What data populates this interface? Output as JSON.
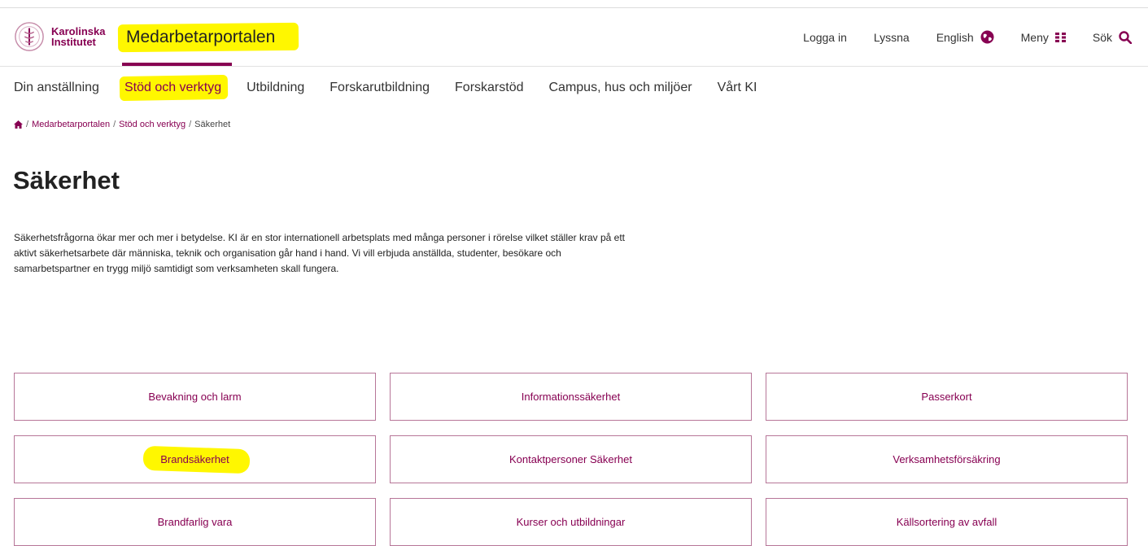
{
  "header": {
    "logo_line1": "Karolinska",
    "logo_line2": "Institutet",
    "portal_title": "Medarbetarportalen",
    "actions": {
      "login": "Logga in",
      "listen": "Lyssna",
      "language": "English",
      "menu": "Meny",
      "search": "Sök"
    }
  },
  "nav": {
    "items": [
      {
        "label": "Din anställning"
      },
      {
        "label": "Stöd och verktyg",
        "highlighted": true
      },
      {
        "label": "Utbildning"
      },
      {
        "label": "Forskarutbildning"
      },
      {
        "label": "Forskarstöd"
      },
      {
        "label": "Campus, hus och miljöer"
      },
      {
        "label": "Vårt KI"
      }
    ]
  },
  "breadcrumb": {
    "items": [
      "Medarbetarportalen",
      "Stöd och verktyg"
    ],
    "current": "Säkerhet",
    "separator": "/"
  },
  "page": {
    "title": "Säkerhet",
    "intro": "Säkerhetsfrågorna ökar mer och mer i betydelse. KI är en stor internationell arbetsplats med många personer i rörelse vilket ställer krav på ett aktivt säkerhetsarbete där människa, teknik och organisation går hand i hand. Vi vill erbjuda anställda, studenter, besökare och samarbetspartner en trygg miljö samtidigt som verksamheten skall fungera."
  },
  "tiles": [
    {
      "label": "Bevakning och larm"
    },
    {
      "label": "Informationssäkerhet"
    },
    {
      "label": "Passerkort"
    },
    {
      "label": "Brandsäkerhet",
      "highlighted": true
    },
    {
      "label": "Kontaktpersoner Säkerhet"
    },
    {
      "label": "Verksamhetsförsäkring"
    },
    {
      "label": "Brandfarlig vara"
    },
    {
      "label": "Kurser och utbildningar"
    },
    {
      "label": "Källsortering av avfall"
    }
  ],
  "colors": {
    "brand": "#870052",
    "highlight": "#fff700",
    "tile_border": "#b77698"
  },
  "icons": [
    "home-icon",
    "globe-icon",
    "grid-menu-icon",
    "search-icon",
    "ki-seal-icon"
  ]
}
